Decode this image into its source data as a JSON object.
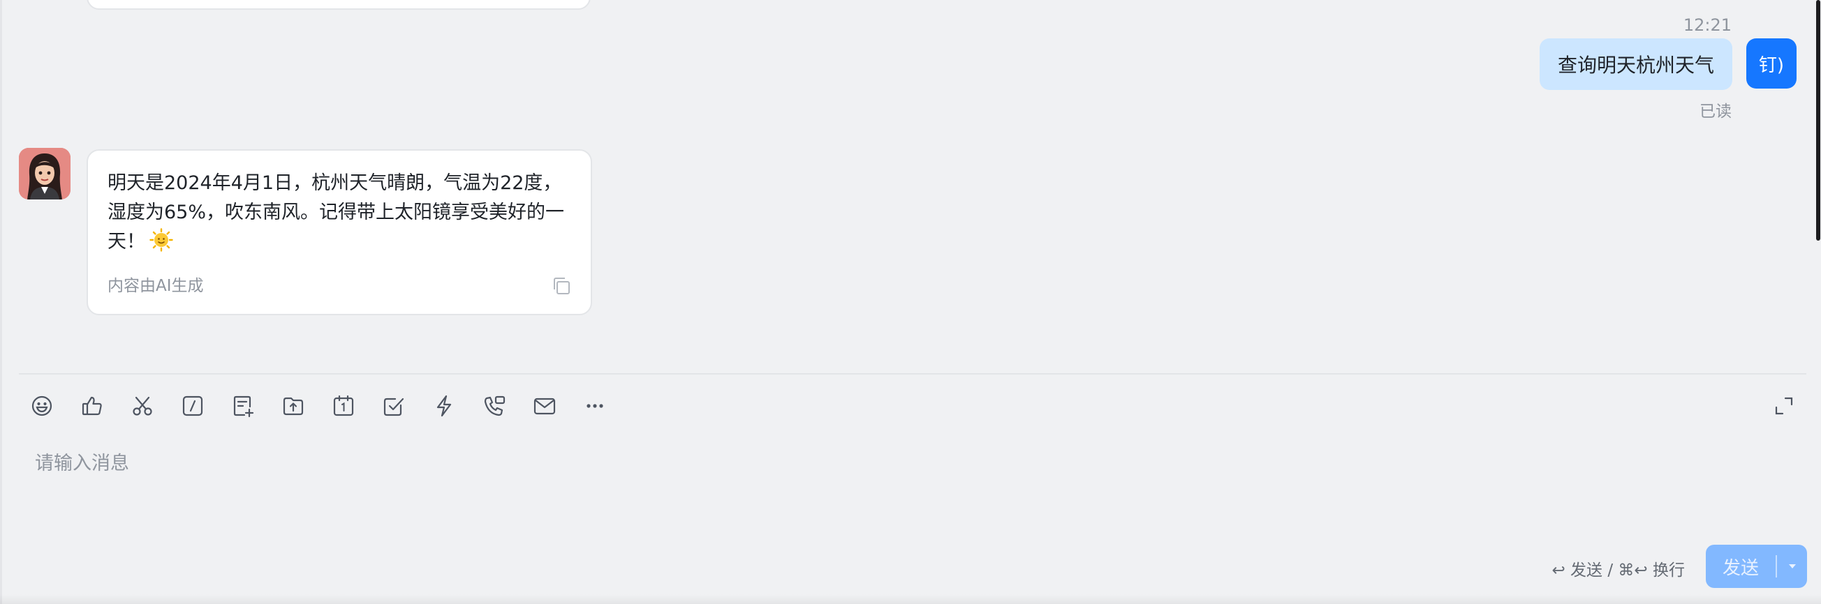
{
  "conversation": {
    "outgoing": {
      "time": "12:21",
      "text": "查询明天杭州天气",
      "status": "已读",
      "avatar_text": "钉)"
    },
    "incoming": {
      "text": "明天是2024年4月1日，杭州天气晴朗，气温为22度，湿度为65%，吹东南风。记得带上太阳镜享受美好的一天！",
      "emoji": "sun-with-face",
      "ai_note": "内容由AI生成"
    }
  },
  "composer": {
    "toolbar_icons": [
      "emoji-icon",
      "thumbs-up-icon",
      "scissors-icon",
      "slash-command-icon",
      "new-doc-icon",
      "upload-folder-icon",
      "calendar-icon",
      "todo-check-icon",
      "lightning-icon",
      "phone-call-icon",
      "mail-icon",
      "more-icon"
    ],
    "placeholder": "请输入消息",
    "hint": "↩ 发送 / ⌘↩ 换行",
    "send_label": "发送"
  },
  "colors": {
    "background": "#f0f1f3",
    "outgoing_bubble": "#cce6ff",
    "accent": "#1677ff",
    "send_button_disabled": "#82b8ff"
  }
}
